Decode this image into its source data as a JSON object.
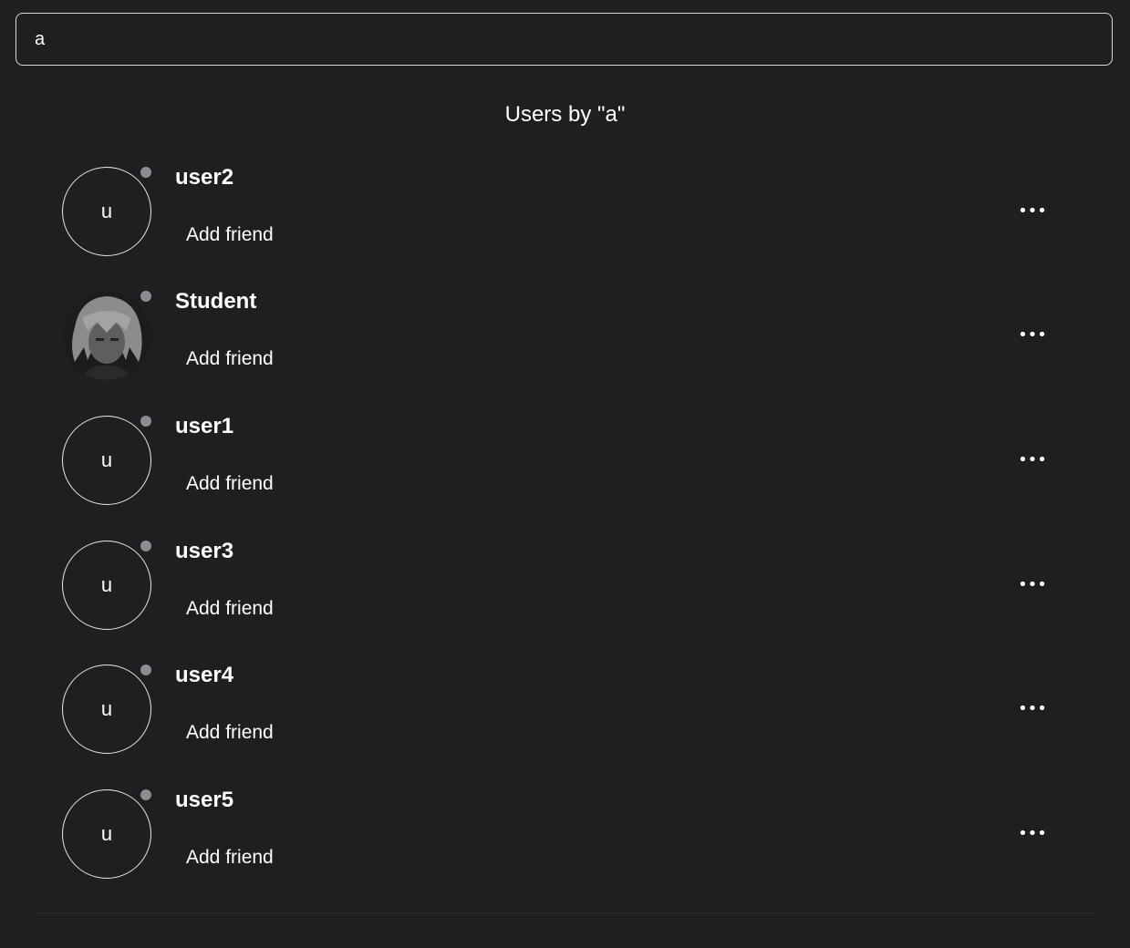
{
  "search": {
    "value": "a"
  },
  "results": {
    "title": "Users by \"a\""
  },
  "users": [
    {
      "name": "user2",
      "avatar_text": "u",
      "avatar_type": "initial",
      "action_label": "Add friend",
      "more_label": "•••"
    },
    {
      "name": "Student",
      "avatar_text": "",
      "avatar_type": "photo",
      "action_label": "Add friend",
      "more_label": "•••"
    },
    {
      "name": "user1",
      "avatar_text": "u",
      "avatar_type": "initial",
      "action_label": "Add friend",
      "more_label": "•••"
    },
    {
      "name": "user3",
      "avatar_text": "u",
      "avatar_type": "initial",
      "action_label": "Add friend",
      "more_label": "•••"
    },
    {
      "name": "user4",
      "avatar_text": "u",
      "avatar_type": "initial",
      "action_label": "Add friend",
      "more_label": "•••"
    },
    {
      "name": "user5",
      "avatar_text": "u",
      "avatar_type": "initial",
      "action_label": "Add friend",
      "more_label": "•••"
    }
  ],
  "colors": {
    "background": "#1f1f21",
    "status_offline": "#8a8d94"
  }
}
